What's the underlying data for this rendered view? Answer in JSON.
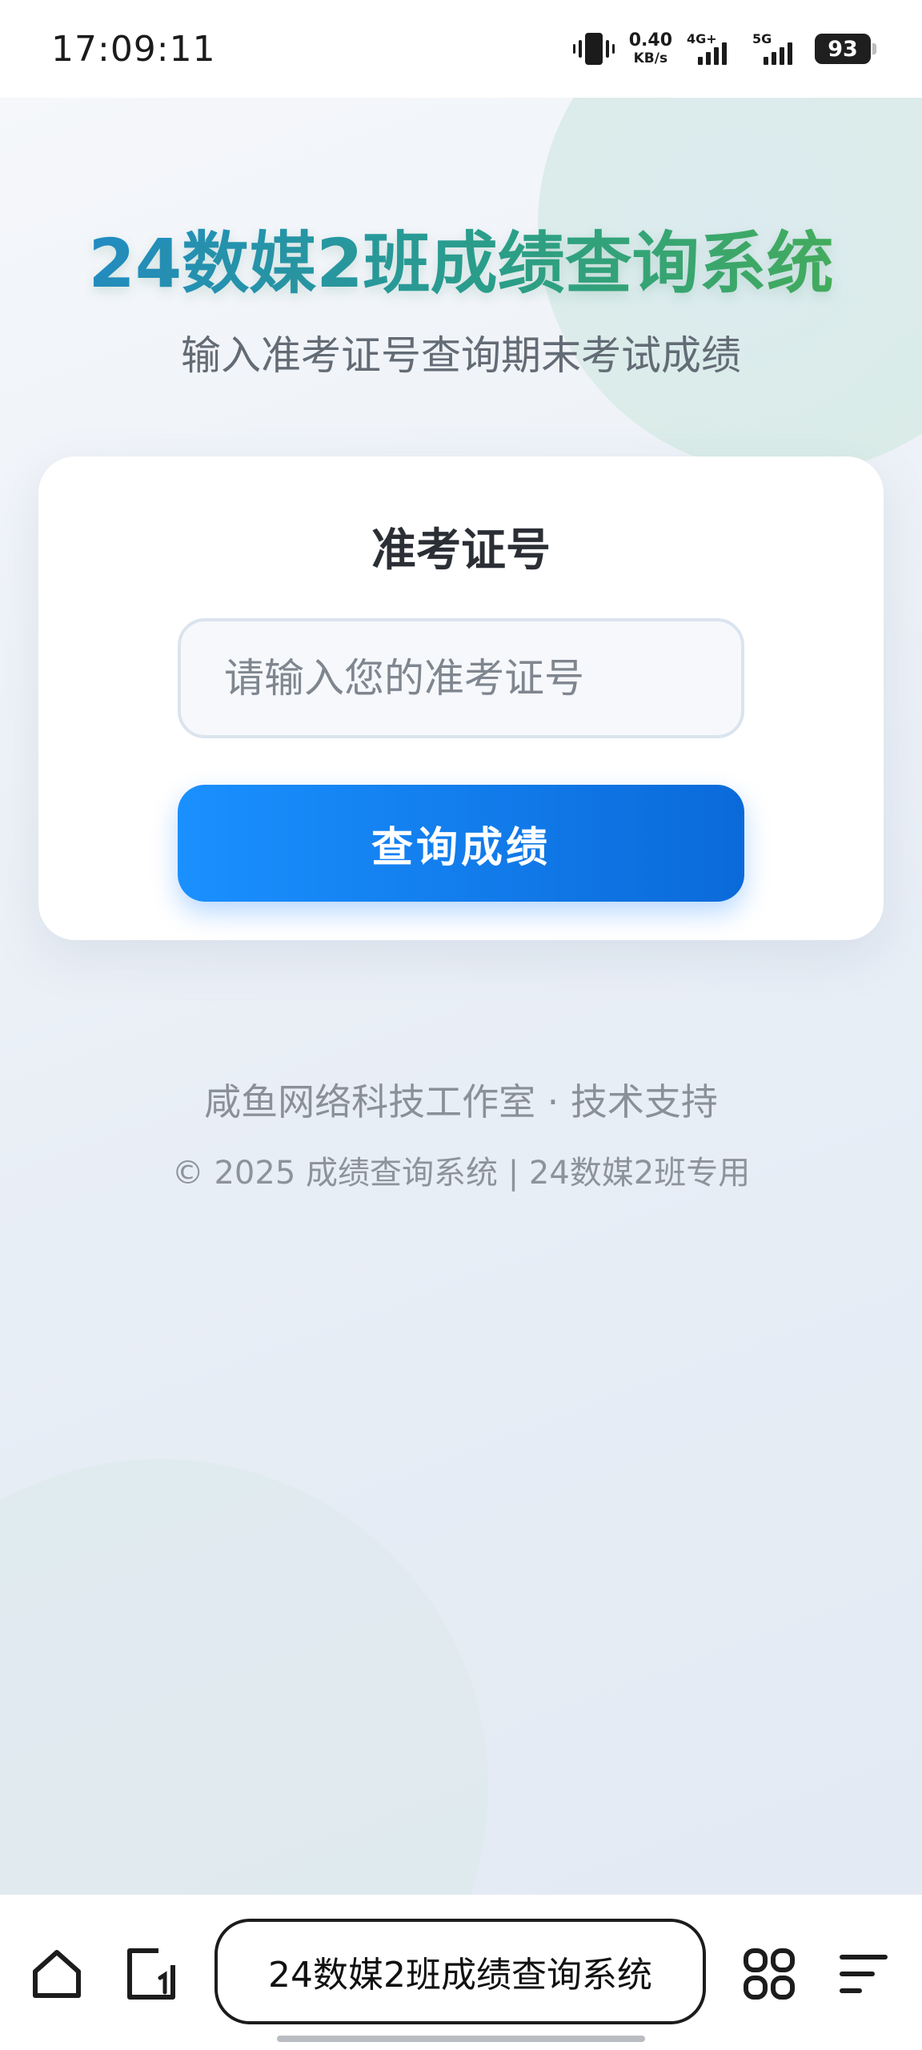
{
  "status_bar": {
    "time": "17:09:11",
    "net_speed_value": "0.40",
    "net_speed_unit": "KB/s",
    "signal1_label": "4G+",
    "signal2_label": "5G",
    "battery": "93"
  },
  "header": {
    "title": "24数媒2班成绩查询系统",
    "subtitle": "输入准考证号查询期末考试成绩"
  },
  "form": {
    "label": "准考证号",
    "input_placeholder": "请输入您的准考证号",
    "input_value": "",
    "submit_label": "查询成绩"
  },
  "footer": {
    "credit": "咸鱼网络科技工作室 · 技术支持",
    "copyright": "© 2025 成绩查询系统 | 24数媒2班专用"
  },
  "browser": {
    "page_title": "24数媒2班成绩查询系统"
  },
  "colors": {
    "primary_button": "#1a90ff",
    "title_gradient_start": "#1e88d6",
    "title_gradient_end": "#4cb34e"
  }
}
